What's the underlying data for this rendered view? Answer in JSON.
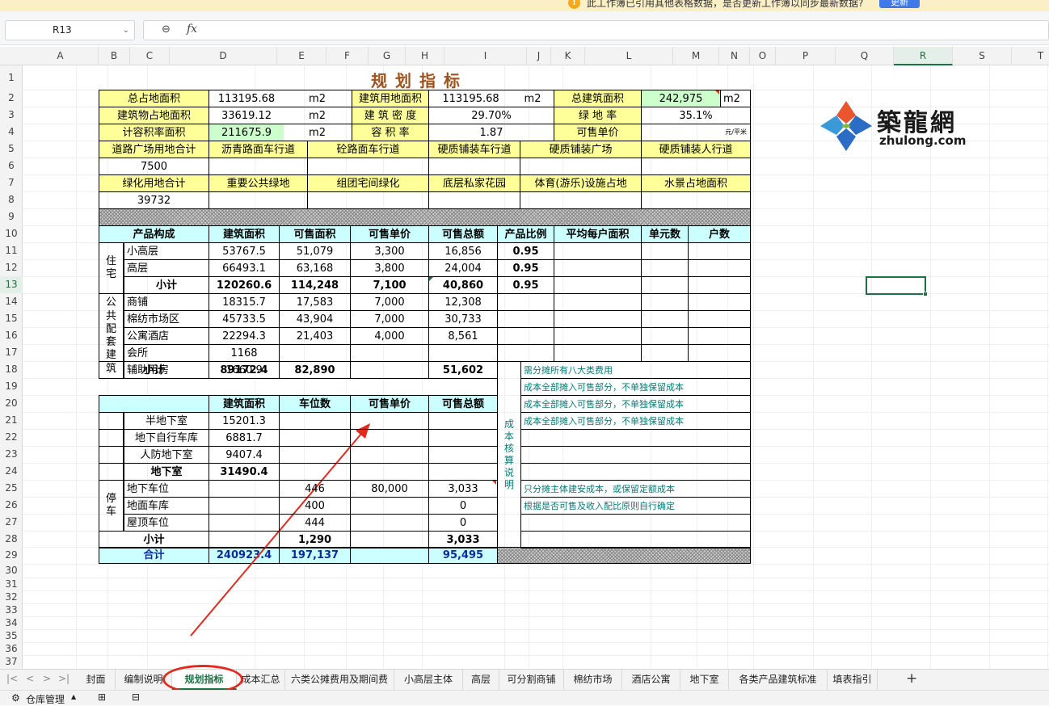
{
  "notification": {
    "message": "此工作簿已引用其他表格数据，是否更新工作簿以同步最新数据?",
    "button": "更新",
    "icon": "!"
  },
  "formula_bar": {
    "name_box": "R13",
    "fx": "fx",
    "zoom_icon": "⊖",
    "dropdown": "⌄"
  },
  "columns": [
    "A",
    "B",
    "C",
    "D",
    "E",
    "F",
    "G",
    "H",
    "I",
    "J",
    "K",
    "L",
    "M",
    "N",
    "O",
    "P",
    "Q",
    "R",
    "S",
    "T"
  ],
  "rows": [
    "1",
    "2",
    "3",
    "4",
    "5",
    "6",
    "7",
    "8",
    "9",
    "10",
    "11",
    "12",
    "13",
    "14",
    "15",
    "16",
    "17",
    "18",
    "19",
    "20",
    "21",
    "22",
    "23",
    "24",
    "25",
    "26",
    "27",
    "28",
    "29",
    "30",
    "31",
    "32",
    "33",
    "34",
    "35",
    "36",
    "37"
  ],
  "sheet": {
    "title": "规划指标",
    "r2": {
      "a": "总占地面积",
      "b": "113195.68",
      "c": "m2",
      "d": "建筑用地面积",
      "e": "113195.68",
      "f": "m2",
      "g": "总建筑面积",
      "h": "242,975",
      "i": "m2"
    },
    "r3": {
      "a": "建筑物占地面积",
      "b": "33619.12",
      "c": "m2",
      "d": "建 筑 密 度",
      "e": "29.70%",
      "g": "绿  地  率",
      "h": "35.1%"
    },
    "r4": {
      "a": "计容积率面积",
      "b": "211675.9",
      "c": "m2",
      "d": "容  积  率",
      "e": "1.87",
      "g": "可售单价",
      "h": "元/平米"
    },
    "r5": [
      "道路广场用地合计",
      "沥青路面车行道",
      "砼路面车行道",
      "硬质铺装车行道",
      "硬质铺装广场",
      "硬质铺装人行道"
    ],
    "r6": "7500",
    "r7": [
      "绿化用地合计",
      "重要公共绿地",
      "组团宅间绿化",
      "底层私家花园",
      "体育(游乐)设施占地",
      "水景占地面积"
    ],
    "r8": "39732",
    "headers": [
      "产品构成",
      "建筑面积",
      "可售面积",
      "可售单价",
      "可售总额",
      "产品比例",
      "平均每户面积",
      "单元数",
      "户数"
    ],
    "group_residential": "住宅",
    "group_public": "公共配套建筑",
    "group_parking": "停车",
    "residential": [
      {
        "name": "小高层",
        "area": "53767.5",
        "sale_area": "51,079",
        "price": "3,300",
        "total": "16,856",
        "ratio": "0.95"
      },
      {
        "name": "高层",
        "area": "66493.1",
        "sale_area": "63,168",
        "price": "3,800",
        "total": "24,004",
        "ratio": "0.95"
      }
    ],
    "res_subtotal": {
      "name": "小计",
      "area": "120260.6",
      "sale_area": "114,248",
      "price": "7,100",
      "total": "40,860",
      "ratio": "0.95"
    },
    "public": [
      {
        "name": "商铺",
        "area": "18315.7",
        "sale_area": "17,583",
        "price": "7,000",
        "total": "12,308"
      },
      {
        "name": "棉纺市场区",
        "area": "45733.5",
        "sale_area": "43,904",
        "price": "7,000",
        "total": "30,733"
      },
      {
        "name": "公寓酒店",
        "area": "22294.3",
        "sale_area": "21,403",
        "price": "4,000",
        "total": "8,561"
      },
      {
        "name": "会所",
        "area": "1168"
      },
      {
        "name": "辅助用房",
        "area": "1660.9"
      }
    ],
    "pub_subtotal": {
      "name": "小计",
      "area": "89172.4",
      "sale_area": "82,890",
      "total": "51,602"
    },
    "basement_headers": [
      "建筑面积",
      "车位数",
      "可售单价",
      "可售总额"
    ],
    "basement": [
      {
        "name": "半地下室",
        "area": "15201.3"
      },
      {
        "name": "地下自行车库",
        "area": "6881.7"
      },
      {
        "name": "人防地下室",
        "area": "9407.4"
      }
    ],
    "basement_total": {
      "name": "地下室",
      "area": "31490.4"
    },
    "parking": [
      {
        "name": "地下车位",
        "spots": "446",
        "price": "80,000",
        "total": "3,033"
      },
      {
        "name": "地面车库",
        "spots": "400",
        "total": "0"
      },
      {
        "name": "屋顶车位",
        "spots": "444",
        "total": "0"
      }
    ],
    "park_subtotal": {
      "name": "小计",
      "spots": "1,290",
      "total": "3,033"
    },
    "grand_total": {
      "name": "合计",
      "area": "240923.4",
      "sale_area": "197,137",
      "total": "95,495"
    },
    "cost_label": "成本核算说明",
    "notes": {
      "n18": "需分摊所有八大类费用",
      "n19": "成本全部摊入可售部分，不单独保留成本",
      "n20": "成本全部摊入可售部分，不单独保留成本",
      "n21": "成本全部摊入可售部分，不单独保留成本",
      "n25": "只分摊主体建安成本，或保留定额成本",
      "n26": "根据是否可售及收入配比原则自行确定"
    }
  },
  "logo": {
    "text": "築龍網",
    "domain": "zhulong.com"
  },
  "tabs": [
    "封面",
    "编制说明",
    "规划指标",
    "成本汇总",
    "六类公摊费用及期间费",
    "小高层主体",
    "高层",
    "可分割商铺",
    "棉纺市场",
    "酒店公寓",
    "地下室",
    "各类产品建筑标准",
    "填表指引"
  ],
  "active_tab": "规划指标",
  "tab_nav": [
    "|<",
    "<",
    ">",
    ">|"
  ],
  "add_tab": "+",
  "status_bar": {
    "warehouse": "仓库管理",
    "caret": "▲"
  }
}
